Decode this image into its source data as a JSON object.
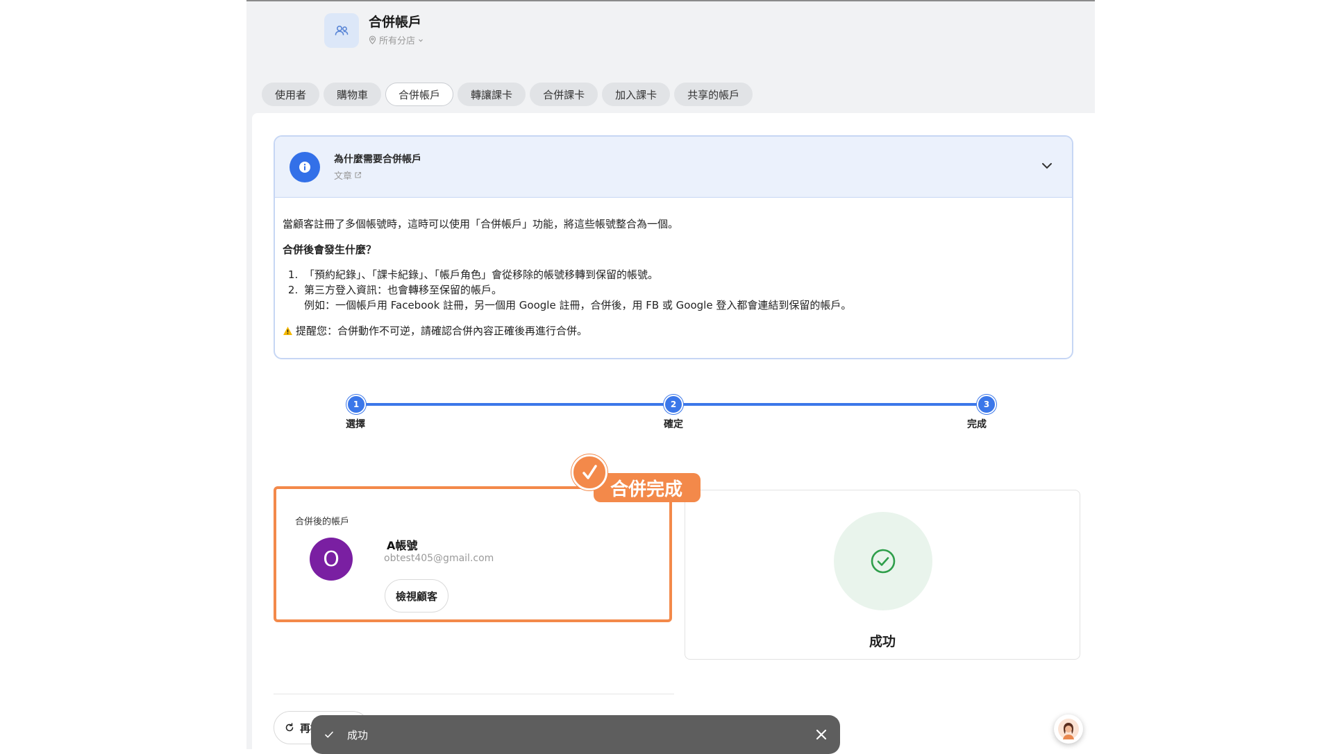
{
  "header": {
    "title": "合併帳戶",
    "branch_label": "所有分店",
    "icon": "users-icon"
  },
  "tabs": [
    {
      "label": "使用者",
      "active": false
    },
    {
      "label": "購物車",
      "active": false
    },
    {
      "label": "合併帳戶",
      "active": true
    },
    {
      "label": "轉讓課卡",
      "active": false
    },
    {
      "label": "合併課卡",
      "active": false
    },
    {
      "label": "加入課卡",
      "active": false
    },
    {
      "label": "共享的帳戶",
      "active": false
    }
  ],
  "info": {
    "title": "為什麼需要合併帳戶",
    "link_label": "文章",
    "intro": "當顧客註冊了多個帳號時，這時可以使用「合併帳戶」功能，將這些帳號整合為一個。",
    "question": "合併後會發生什麼？",
    "items": [
      "「預約紀錄」、「課卡紀錄」、「帳戶角色」會從移除的帳號移轉到保留的帳號。",
      "第三方登入資訊：也會轉移至保留的帳戶。"
    ],
    "example": "例如：一個帳戶用 Facebook 註冊，另一個用 Google 註冊，合併後，用 FB 或 Google 登入都會連結到保留的帳戶。",
    "warning": "提醒您：合併動作不可逆，請確認合併內容正確後再進行合併。"
  },
  "steps": [
    {
      "number": "1",
      "label": "選擇"
    },
    {
      "number": "2",
      "label": "確定"
    },
    {
      "number": "3",
      "label": "完成"
    }
  ],
  "merged": {
    "section_label": "合併後的帳戶",
    "avatar_letter": "O",
    "account_name": "A帳號",
    "email": "obtest405@gmail.com",
    "view_button": "檢視顧客",
    "badge": "合併完成"
  },
  "result": {
    "label": "成功"
  },
  "redo_button": "再操作一次",
  "toast": {
    "message": "成功"
  },
  "colors": {
    "accent_blue": "#3b77e9",
    "annotation_orange": "#f3894a",
    "avatar_purple": "#7a1fa2",
    "success_green": "#2e9e4a"
  }
}
